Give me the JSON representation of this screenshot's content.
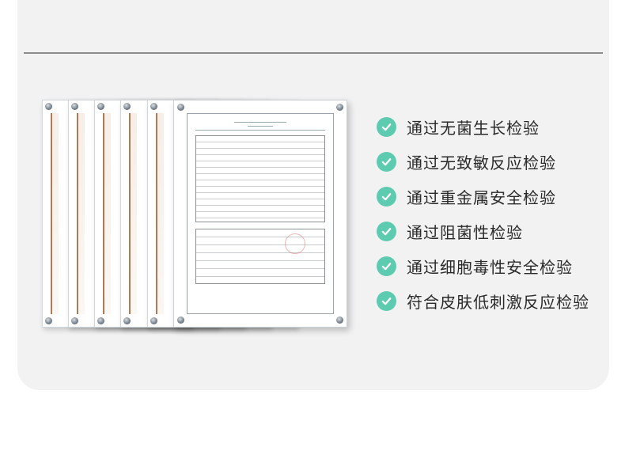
{
  "checklist": [
    {
      "label": "通过无菌生长检验",
      "icon": "check-icon"
    },
    {
      "label": "通过无致敏反应检验",
      "icon": "check-icon"
    },
    {
      "label": "通过重金属安全检验",
      "icon": "check-icon"
    },
    {
      "label": "通过阻菌性检验",
      "icon": "check-icon"
    },
    {
      "label": "通过细胞毒性安全检验",
      "icon": "check-icon"
    },
    {
      "label": "符合皮肤低刺激反应检验",
      "icon": "check-icon"
    }
  ],
  "colors": {
    "accent": "#5ccbb0",
    "card_background": "#f2f2f2",
    "text": "#2a2a2a"
  }
}
